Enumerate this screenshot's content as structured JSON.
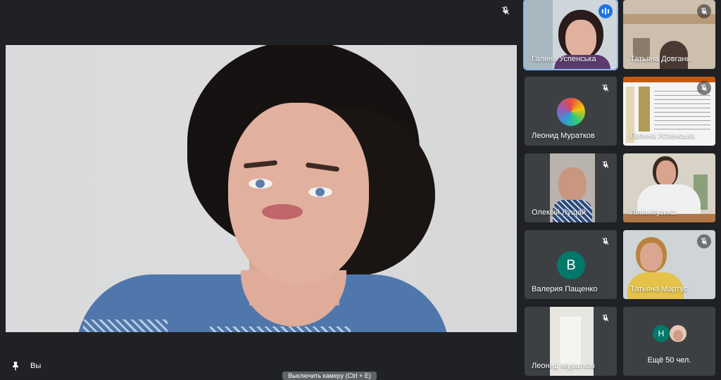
{
  "self": {
    "label": "Вы"
  },
  "tooltip": "Выключить камеру (Ctrl + E)",
  "more": {
    "label": "Ещё 50 чел.",
    "avatar_letter": "Н"
  },
  "participants": [
    {
      "name": "Галина Успенська",
      "speaking": true
    },
    {
      "name": "Татьяна Довгань",
      "muted": true
    },
    {
      "name": "Леонид Муратков",
      "muted": true
    },
    {
      "name": "Галина Успенська",
      "muted": true,
      "presenting": true
    },
    {
      "name": "Олексій Лущай",
      "muted": true
    },
    {
      "name": "Лілія Музика",
      "muted": false
    },
    {
      "name": "Валерия Пащенко",
      "muted": true,
      "avatar_letter": "В"
    },
    {
      "name": "Татьяна Мартус",
      "muted": true
    },
    {
      "name": "Леонид Муратков",
      "muted": true
    }
  ],
  "colors": {
    "background": "#202124",
    "tile": "#3c4043",
    "speaking": "#1a73e8",
    "avatar": "#00796b"
  }
}
